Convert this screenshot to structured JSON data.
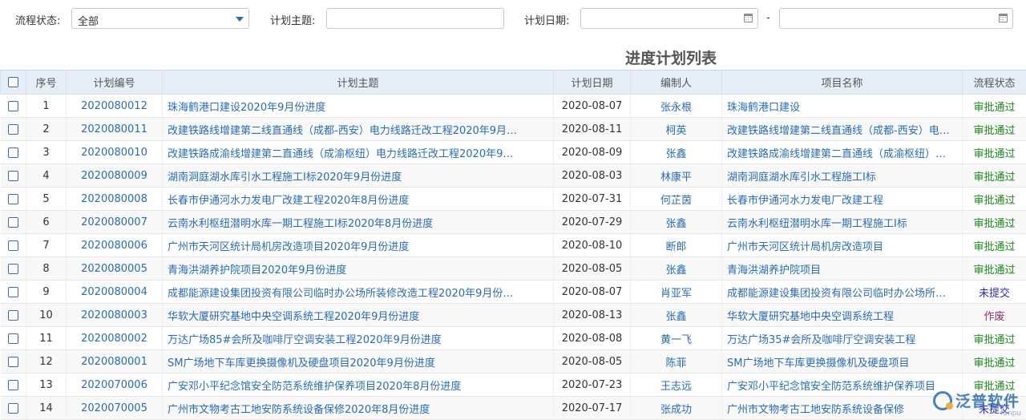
{
  "filters": {
    "status_label": "流程状态:",
    "status_value": "全部",
    "subject_label": "计划主题:",
    "subject_value": "",
    "date_label": "计划日期:",
    "date_from": "",
    "date_to": "",
    "date_sep": "-"
  },
  "list_title": "进度计划列表",
  "columns": {
    "seq": "序号",
    "code": "计划编号",
    "subject": "计划主题",
    "date": "计划日期",
    "author": "编制人",
    "project": "项目名称",
    "status": "流程状态"
  },
  "rows": [
    {
      "seq": "1",
      "code": "2020080012",
      "subject": "珠海鹤港口建设2020年9月份进度",
      "date": "2020-08-07",
      "author": "张永根",
      "project": "珠海鹤港口建设",
      "status": "审批通过"
    },
    {
      "seq": "2",
      "code": "2020080011",
      "subject": "改建铁路线增建第二线直通线（成都-西安）电力线路迁改工程2020年9月…",
      "date": "2020-08-11",
      "author": "柯英",
      "project": "改建铁路线增建第二线直通线（成都-西安）电…",
      "status": "审批通过"
    },
    {
      "seq": "3",
      "code": "2020080010",
      "subject": "改建铁路成渝线增建第二直通线（成渝枢纽）电力线路迁改工程2020年9…",
      "date": "2020-08-09",
      "author": "张鑫",
      "project": "改建铁路成渝线增建第二直通线（成渝枢纽）…",
      "status": "审批通过"
    },
    {
      "seq": "4",
      "code": "2020080009",
      "subject": "湖南洞庭湖水库引水工程施工I标2020年9月份进度",
      "date": "2020-08-03",
      "author": "林康平",
      "project": "湖南洞庭湖水库引水工程施工I标",
      "status": "审批通过"
    },
    {
      "seq": "5",
      "code": "2020080008",
      "subject": "长春市伊通河水力发电厂改建工程2020年8月份进度",
      "date": "2020-07-31",
      "author": "何芷茵",
      "project": "长春市伊通河水力发电厂改建工程",
      "status": "审批通过"
    },
    {
      "seq": "6",
      "code": "2020080007",
      "subject": "云南水利枢纽潜明水库一期工程施工I标2020年8月份进度",
      "date": "2020-07-29",
      "author": "张鑫",
      "project": "云南水利枢纽潜明水库一期工程施工I标",
      "status": "审批通过"
    },
    {
      "seq": "7",
      "code": "2020080006",
      "subject": "广州市天河区统计局机房改造项目2020年9月份进度",
      "date": "2020-08-10",
      "author": "断郎",
      "project": "广州市天河区统计局机房改造项目",
      "status": "审批通过"
    },
    {
      "seq": "8",
      "code": "2020080005",
      "subject": "青海洪湖养护院项目2020年9月份进度",
      "date": "2020-08-05",
      "author": "张鑫",
      "project": "青海洪湖养护院项目",
      "status": "审批通过"
    },
    {
      "seq": "9",
      "code": "2020080004",
      "subject": "成都能源建设集团投资有限公司临时办公场所装修改造工程2020年9月份…",
      "date": "2020-08-07",
      "author": "肖亚军",
      "project": "成都能源建设集团投资有限公司临时办公场所…",
      "status": "未提交"
    },
    {
      "seq": "10",
      "code": "2020080003",
      "subject": "华软大厦研究基地中央空调系统工程2020年9月份进度",
      "date": "2020-08-13",
      "author": "张鑫",
      "project": "华软大厦研究基地中央空调系统工程",
      "status": "作废"
    },
    {
      "seq": "11",
      "code": "2020080002",
      "subject": "万达广场85#会所及咖啡厅空调安装工程2020年9月份进度",
      "date": "2020-08-08",
      "author": "黄一飞",
      "project": "万达广场35#会所及咖啡厅空调安装工程",
      "status": "审批通过"
    },
    {
      "seq": "12",
      "code": "2020080001",
      "subject": "SM广场地下车库更换摄像机及硬盘项目2020年9月份进度",
      "date": "2020-08-05",
      "author": "陈菲",
      "project": "SM广场地下车库更换摄像机及硬盘项目",
      "status": "审批通过"
    },
    {
      "seq": "13",
      "code": "2020070006",
      "subject": "广安邓小平纪念馆安全防范系统维护保养项目2020年8月份进度",
      "date": "2020-07-23",
      "author": "王志远",
      "project": "广安邓小平纪念馆安全防范系统维护保养项目",
      "status": "审批通过"
    },
    {
      "seq": "14",
      "code": "2020070005",
      "subject": "广州市文物考古工地安防系统设备保修2020年8月份进度",
      "date": "2020-07-17",
      "author": "张成功",
      "project": "广州市文物考古工地安防系统设备保修",
      "status": "未提交"
    }
  ],
  "watermark": {
    "text": "泛普软件",
    "url": "fanpu"
  },
  "colors": {
    "link": "#2a6cb0",
    "approved": "#1a8a1a",
    "draft": "#2b2bb5",
    "void": "#9b2a6e",
    "header_bg": "#e6eff8"
  }
}
